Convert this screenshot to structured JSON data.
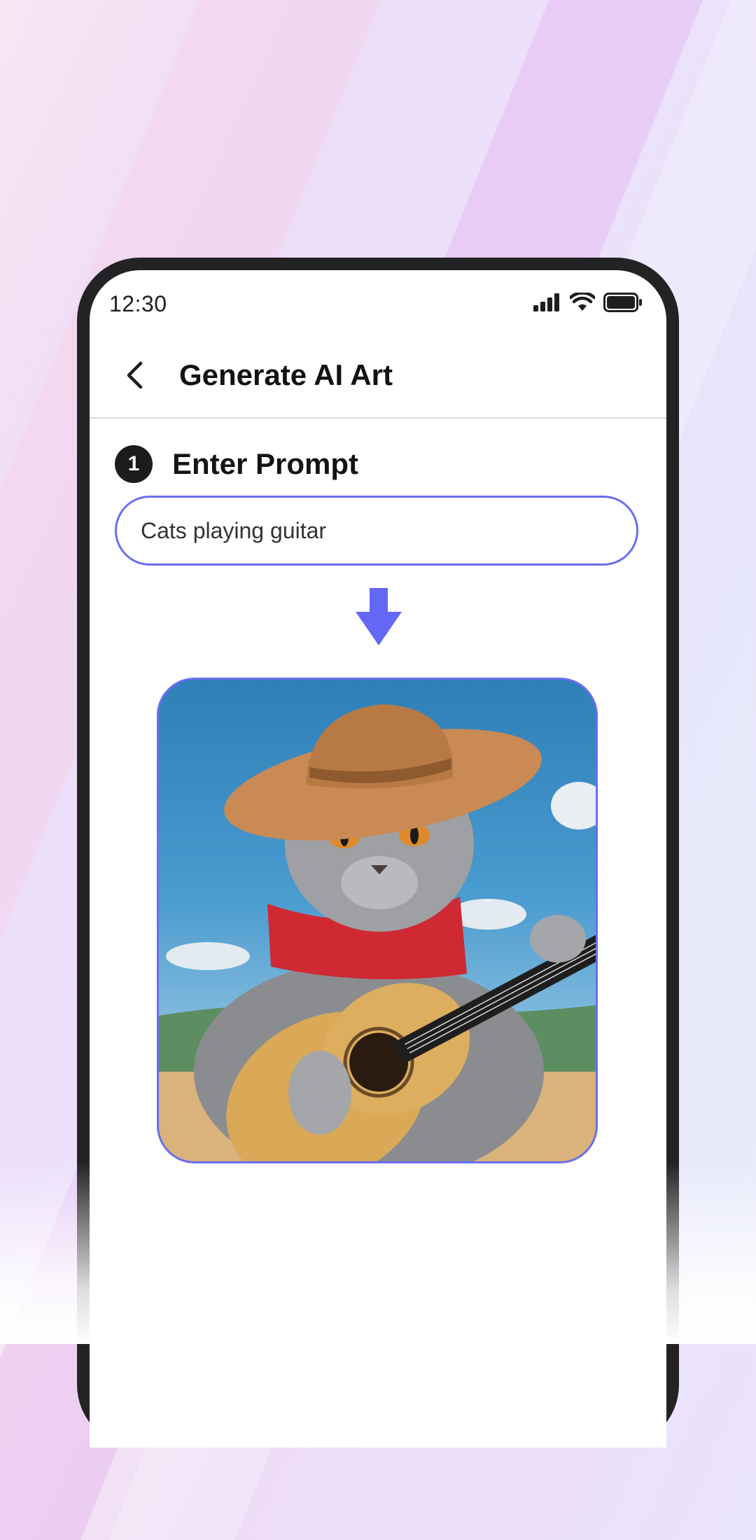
{
  "status_bar": {
    "time": "12:30"
  },
  "header": {
    "title": "Generate AI Art",
    "back_icon": "chevron-left-icon"
  },
  "step": {
    "number": "1",
    "title": "Enter Prompt"
  },
  "prompt": {
    "value": "Cats playing guitar"
  },
  "colors": {
    "accent": "#6a6ef0",
    "arrow": "#6468f7",
    "dark": "#1c1c1c"
  },
  "result_image": {
    "icon": "generated-art-image"
  }
}
